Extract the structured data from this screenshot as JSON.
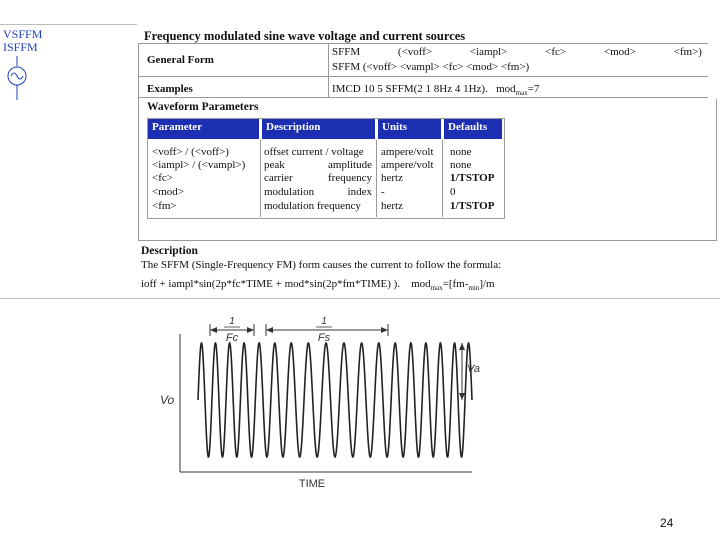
{
  "sidebar": {
    "vsffm": "VSFFM",
    "isffm": "ISFFM"
  },
  "title": "Frequency modulated sine wave voltage and current sources",
  "general_form": {
    "label": "General Form",
    "line1_items": [
      "SFFM",
      "(<voff>",
      "<iampl>",
      "<fc>",
      "<mod>",
      "<fm>)"
    ],
    "line2": "SFFM (<voff> <vampl> <fc> <mod> <fm>)"
  },
  "examples": {
    "label": "Examples",
    "value": "IMCD 10 5 SFFM(2 1 8Hz 4 1Hz)",
    "mod_text": "mod",
    "mod_sub": "max",
    "mod_value": "=7"
  },
  "waveform_parameters": {
    "title": "Waveform Parameters",
    "headers": [
      "Parameter",
      "Description",
      "Units",
      "Defaults"
    ],
    "rows": [
      {
        "param": "<voff>  /  (<voff>)",
        "desc_left": "offset current / voltage",
        "desc_right": "",
        "units": "ampere/volt",
        "default": "none",
        "bold": false
      },
      {
        "param": "<iampl> / (<vampl>)",
        "desc_left": "peak",
        "desc_right": "amplitude",
        "units": "ampere/volt",
        "default": "none",
        "bold": false
      },
      {
        "param": "<fc>",
        "desc_left": "carrier",
        "desc_right": "frequency",
        "units": "hertz",
        "default": "1/TSTOP",
        "bold": true
      },
      {
        "param": "<mod>",
        "desc_left": "modulation",
        "desc_right": "index",
        "units": "-",
        "default": "0",
        "bold": false
      },
      {
        "param": "<fm>",
        "desc_left": "modulation frequency",
        "desc_right": "",
        "units": "hertz",
        "default": "1/TSTOP",
        "bold": true
      }
    ]
  },
  "description": {
    "title": "Description",
    "text": "The SFFM (Single-Frequency FM) form causes the current to follow the formula:",
    "formula": "ioff + iampl*sin(2p*fc*TIME + mod*sin(2p*fm*TIME) ).",
    "formula_extra": "mod",
    "formula_extra_sub": "max",
    "formula_extra_rest": "=[fm-",
    "formula_extra_sub2": "min",
    "formula_extra_rest2": "]/m"
  },
  "figure": {
    "fc_num": "1",
    "fc_den": "Fc",
    "fs_num": "1",
    "fs_den": "Fs",
    "vo": "Vo",
    "va": "Va",
    "time": "TIME"
  },
  "page_number": "24"
}
